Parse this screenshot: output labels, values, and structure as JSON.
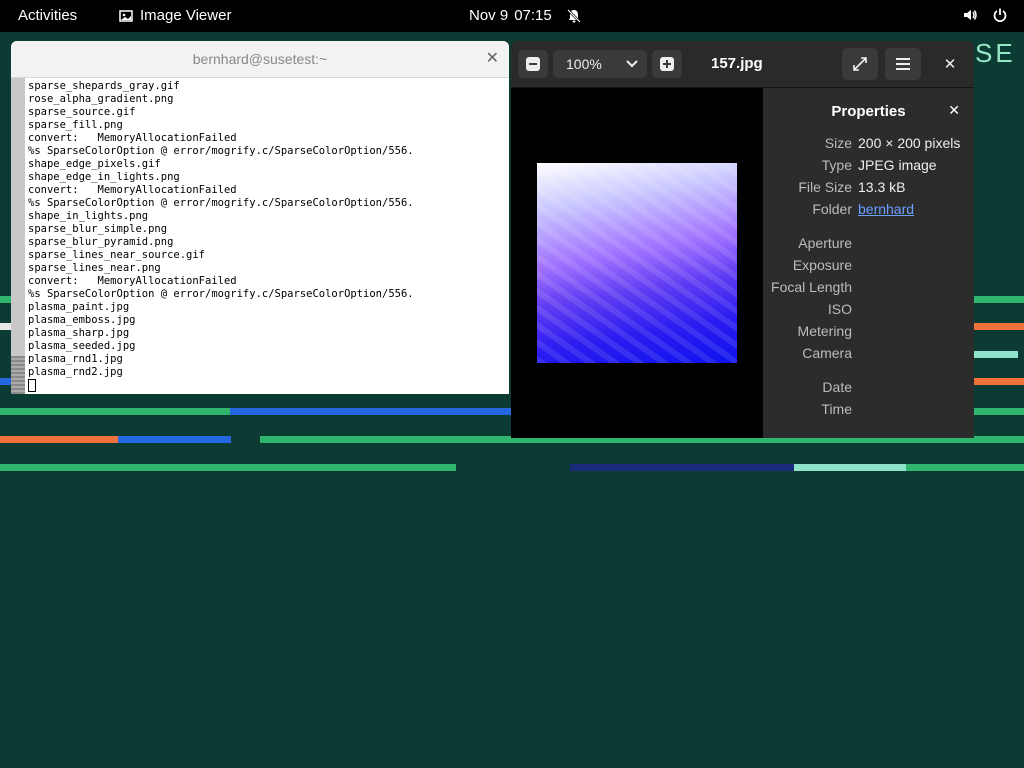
{
  "topbar": {
    "activities": "Activities",
    "app_name": "Image Viewer",
    "date": "Nov 9",
    "time": "07:15",
    "icons": [
      "notifications-off-icon",
      "volume-icon",
      "power-icon"
    ]
  },
  "desktop": {
    "logo_text": "SE",
    "background": "#0b3b32"
  },
  "terminal": {
    "title": "bernhard@susetest:~",
    "lines": [
      "sparse_shepards_gray.gif",
      "rose_alpha_gradient.png",
      "sparse_source.gif",
      "sparse_fill.png",
      "convert:   MemoryAllocationFailed",
      "%s SparseColorOption @ error/mogrify.c/SparseColorOption/556.",
      "shape_edge_pixels.gif",
      "shape_edge_in_lights.png",
      "convert:   MemoryAllocationFailed",
      "%s SparseColorOption @ error/mogrify.c/SparseColorOption/556.",
      "shape_in_lights.png",
      "sparse_blur_simple.png",
      "sparse_blur_pyramid.png",
      "sparse_lines_near_source.gif",
      "sparse_lines_near.png",
      "convert:   MemoryAllocationFailed",
      "%s SparseColorOption @ error/mogrify.c/SparseColorOption/556.",
      "plasma_paint.jpg",
      "plasma_emboss.jpg",
      "plasma_sharp.jpg",
      "plasma_seeded.jpg",
      "plasma_rnd1.jpg",
      "plasma_rnd2.jpg"
    ]
  },
  "viewer": {
    "zoom": "100%",
    "filename": "157.jpg",
    "properties": {
      "title": "Properties",
      "size_label": "Size",
      "size_value": "200 × 200 pixels",
      "type_label": "Type",
      "type_value": "JPEG image",
      "filesize_label": "File Size",
      "filesize_value": "13.3 kB",
      "folder_label": "Folder",
      "folder_value": "bernhard",
      "aperture_label": "Aperture",
      "exposure_label": "Exposure",
      "focal_label": "Focal Length",
      "iso_label": "ISO",
      "metering_label": "Metering",
      "camera_label": "Camera",
      "date_label": "Date",
      "time_label": "Time"
    }
  }
}
